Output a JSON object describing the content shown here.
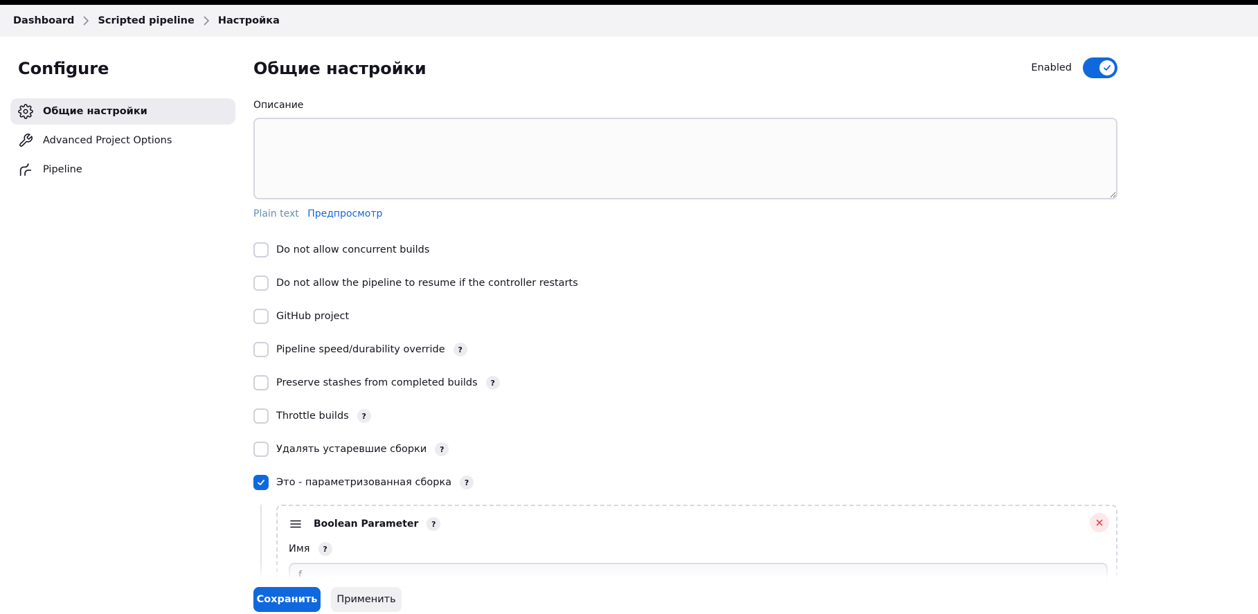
{
  "breadcrumb": {
    "items": [
      "Dashboard",
      "Scripted pipeline",
      "Настройка"
    ]
  },
  "sidebar": {
    "title": "Configure",
    "items": [
      {
        "label": "Общие настройки",
        "icon": "gear-icon",
        "active": true
      },
      {
        "label": "Advanced Project Options",
        "icon": "wrench-icon",
        "active": false
      },
      {
        "label": "Pipeline",
        "icon": "pipeline-icon",
        "active": false
      }
    ]
  },
  "main": {
    "title": "Общие настройки",
    "enabled_label": "Enabled",
    "enabled": true,
    "description_label": "Описание",
    "description_value": "",
    "plain_text": "Plain text",
    "preview_link": "Предпросмотр",
    "options": [
      {
        "label": "Do not allow concurrent builds",
        "checked": false,
        "help": false
      },
      {
        "label": "Do not allow the pipeline to resume if the controller restarts",
        "checked": false,
        "help": false
      },
      {
        "label": "GitHub project",
        "checked": false,
        "help": false
      },
      {
        "label": "Pipeline speed/durability override",
        "checked": false,
        "help": true
      },
      {
        "label": "Preserve stashes from completed builds",
        "checked": false,
        "help": true
      },
      {
        "label": "Throttle builds",
        "checked": false,
        "help": true
      },
      {
        "label": "Удалять устаревшие сборки",
        "checked": false,
        "help": true
      },
      {
        "label": "Это - параметризованная сборка",
        "checked": true,
        "help": true
      }
    ],
    "help_glyph": "?",
    "parameter": {
      "title": "Boolean Parameter",
      "name_label": "Имя",
      "name_value": "f"
    }
  },
  "footer": {
    "save_label": "Сохранить",
    "apply_label": "Применить"
  },
  "colors": {
    "accent": "#1068df",
    "danger": "#e5484d"
  }
}
